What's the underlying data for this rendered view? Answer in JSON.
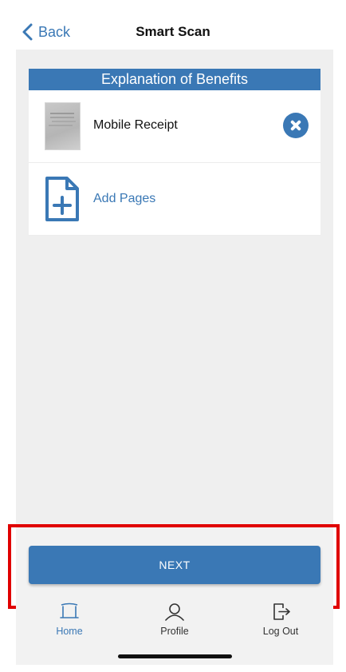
{
  "header": {
    "back_label": "Back",
    "title": "Smart Scan"
  },
  "card": {
    "title": "Explanation of Benefits",
    "documents": [
      {
        "label": "Mobile Receipt"
      }
    ],
    "add_pages_label": "Add Pages"
  },
  "actions": {
    "next_label": "NEXT"
  },
  "tabbar": {
    "items": [
      {
        "label": "Home",
        "icon": "home-icon",
        "active": true
      },
      {
        "label": "Profile",
        "icon": "profile-icon",
        "active": false
      },
      {
        "label": "Log Out",
        "icon": "logout-icon",
        "active": false
      }
    ]
  },
  "colors": {
    "accent": "#3a78b5",
    "highlight": "#e00000",
    "background": "#efefef"
  }
}
